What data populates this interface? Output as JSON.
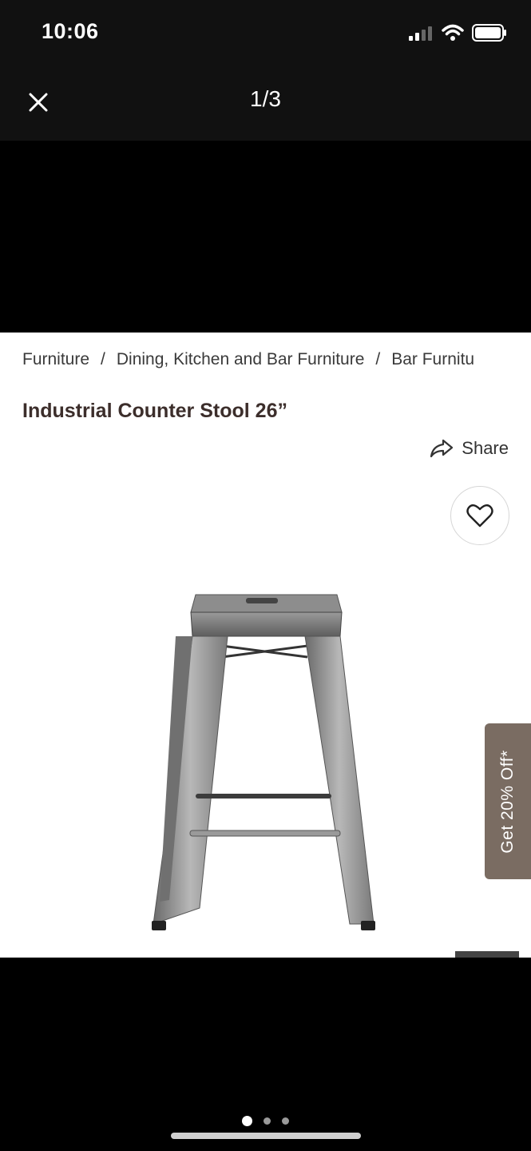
{
  "status": {
    "time": "10:06"
  },
  "viewer": {
    "counter": "1/3",
    "dots": 3,
    "active_index": 0
  },
  "breadcrumb": [
    "Furniture",
    "Dining, Kitchen and Bar Furniture",
    "Bar Furnitu"
  ],
  "product": {
    "title": "Industrial Counter Stool 26”"
  },
  "actions": {
    "share_label": "Share"
  },
  "promo": {
    "label": "Get 20% Off*"
  },
  "icons": [
    "signal-icon",
    "wifi-icon",
    "battery-icon",
    "close-icon",
    "share-icon",
    "heart-icon"
  ]
}
